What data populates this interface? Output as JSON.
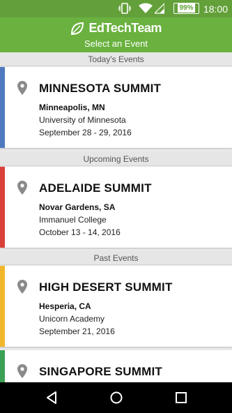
{
  "status_bar": {
    "battery": "99%",
    "time": "18:00"
  },
  "header": {
    "logo": "EdTechTeam",
    "subtitle": "Select an Event"
  },
  "sections": {
    "today": "Today's Events",
    "upcoming": "Upcoming Events",
    "past": "Past Events"
  },
  "events": [
    {
      "title": "MINNESOTA SUMMIT",
      "city": "Minneapolis, MN",
      "venue": "University of Minnesota",
      "dates": "September 28 - 29, 2016",
      "accent": "#4f7ac0"
    },
    {
      "title": "ADELAIDE SUMMIT",
      "city": "Novar Gardens, SA",
      "venue": "Immanuel College",
      "dates": "October 13 - 14, 2016",
      "accent": "#d9413a"
    },
    {
      "title": "HIGH DESERT SUMMIT",
      "city": "Hesperia, CA",
      "venue": "Unicorn Academy",
      "dates": "September 21, 2016",
      "accent": "#f1b62a"
    },
    {
      "title": "SINGAPORE SUMMIT",
      "city": "",
      "venue": "",
      "dates": "",
      "accent": "#3aa154"
    }
  ]
}
